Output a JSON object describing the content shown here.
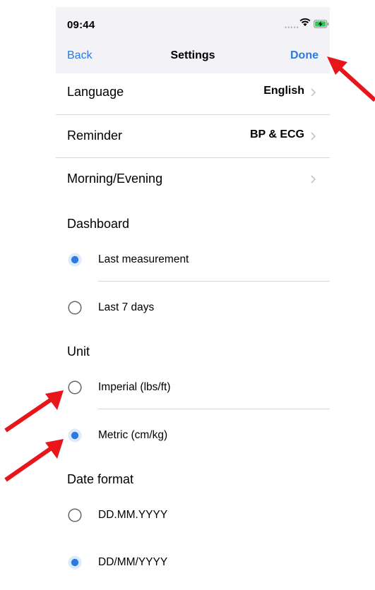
{
  "status_bar": {
    "time": "09:44",
    "signal_icon": "signal-dots-icon",
    "wifi_icon": "wifi-icon",
    "battery_icon": "battery-charging-icon"
  },
  "nav": {
    "back_label": "Back",
    "title": "Settings",
    "done_label": "Done"
  },
  "rows": {
    "language": {
      "label": "Language",
      "value": "English"
    },
    "reminder": {
      "label": "Reminder",
      "value": "BP & ECG"
    },
    "morning_evening": {
      "label": "Morning/Evening",
      "value": ""
    }
  },
  "sections": {
    "dashboard": {
      "title": "Dashboard",
      "options": [
        {
          "label": "Last measurement",
          "selected": true
        },
        {
          "label": "Last 7 days",
          "selected": false
        }
      ]
    },
    "unit": {
      "title": "Unit",
      "options": [
        {
          "label": "Imperial (lbs/ft)",
          "selected": false
        },
        {
          "label": "Metric (cm/kg)",
          "selected": true
        }
      ]
    },
    "date_format": {
      "title": "Date format",
      "options": [
        {
          "label": "DD.MM.YYYY",
          "selected": false
        },
        {
          "label": "DD/MM/YYYY",
          "selected": true
        }
      ]
    }
  },
  "colors": {
    "accent": "#2a7ae2",
    "annotation_arrow": "#e8151b",
    "bar_background": "#f2f2f7"
  }
}
